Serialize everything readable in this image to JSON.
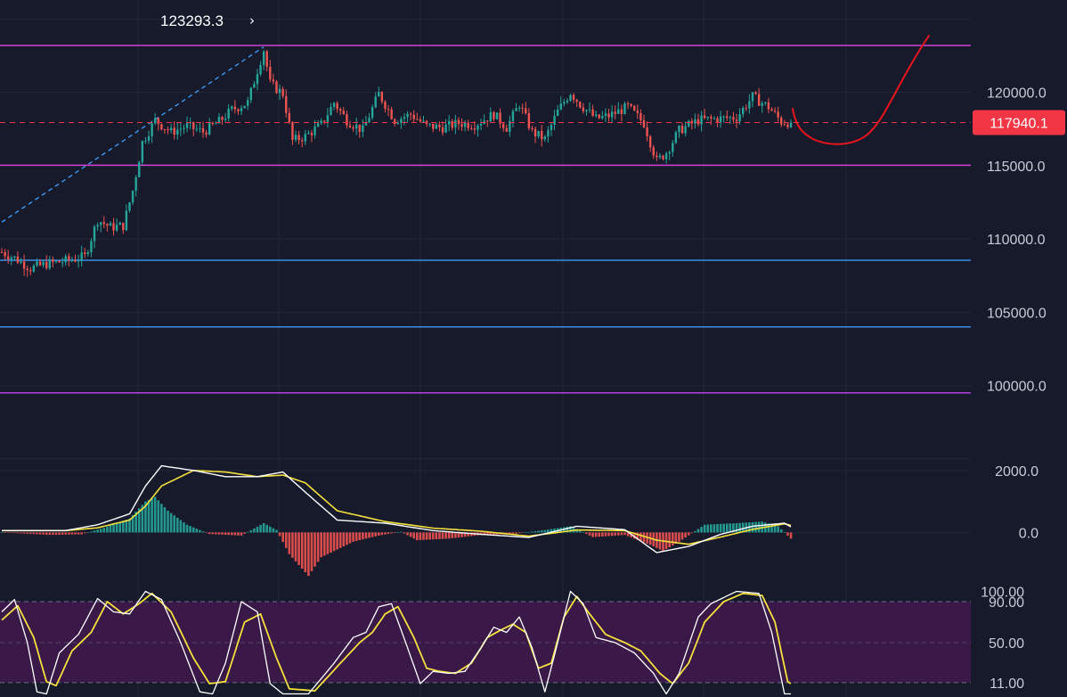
{
  "colors": {
    "background": "#161a2b",
    "grid": "#232838",
    "up": "#26a69a",
    "down": "#ef5350",
    "magenta_level": "#d63fd6",
    "blue_level": "#3b8ee8",
    "purple_level": "#b43fe0",
    "current_price": "#f23645",
    "trend_line": "#3fa0ff",
    "macd_line": "#ffffff",
    "signal_line": "#f5e03c",
    "stoch_k": "#ffffff",
    "stoch_d": "#f5e03c",
    "stoch_band": "#3a1948",
    "drawing": "#e8141e"
  },
  "chart_data": [
    {
      "name": "price",
      "type": "candlestick",
      "y_ticks": [
        "120000.0",
        "115000.0",
        "110000.0",
        "105000.0",
        "100000.0"
      ],
      "y_tick_values": [
        120000,
        115000,
        110000,
        105000,
        100000
      ],
      "ylim": [
        95900,
        126300
      ],
      "current_price": 117940.1,
      "current_price_label": "117940.1",
      "peak_value": 123293.3,
      "peak_label": "123293.3",
      "horizontal_levels": [
        {
          "value": 123200,
          "color": "magenta"
        },
        {
          "value": 115030,
          "color": "magenta"
        },
        {
          "value": 108550,
          "color": "blue"
        },
        {
          "value": 104000,
          "color": "blue"
        },
        {
          "value": 99500,
          "color": "purple"
        }
      ],
      "trend_line": {
        "from": [
          0,
          111150
        ],
        "to": [
          82,
          123100
        ],
        "style": "dashed"
      },
      "key_closes": [
        {
          "i": 0,
          "c": 109100
        },
        {
          "i": 4,
          "c": 108700
        },
        {
          "i": 9,
          "c": 108000
        },
        {
          "i": 14,
          "c": 108300
        },
        {
          "i": 20,
          "c": 108500
        },
        {
          "i": 26,
          "c": 108800
        },
        {
          "i": 30,
          "c": 111300
        },
        {
          "i": 34,
          "c": 110800
        },
        {
          "i": 38,
          "c": 110900
        },
        {
          "i": 41,
          "c": 113300
        },
        {
          "i": 44,
          "c": 116600
        },
        {
          "i": 48,
          "c": 118100
        },
        {
          "i": 53,
          "c": 117300
        },
        {
          "i": 58,
          "c": 117700
        },
        {
          "i": 63,
          "c": 117300
        },
        {
          "i": 68,
          "c": 118000
        },
        {
          "i": 72,
          "c": 118800
        },
        {
          "i": 77,
          "c": 119300
        },
        {
          "i": 80,
          "c": 121500
        },
        {
          "i": 82,
          "c": 122900
        },
        {
          "i": 84,
          "c": 120600
        },
        {
          "i": 88,
          "c": 119900
        },
        {
          "i": 91,
          "c": 116700
        },
        {
          "i": 95,
          "c": 117000
        },
        {
          "i": 100,
          "c": 117800
        },
        {
          "i": 104,
          "c": 119300
        },
        {
          "i": 108,
          "c": 118100
        },
        {
          "i": 113,
          "c": 117400
        },
        {
          "i": 118,
          "c": 119900
        },
        {
          "i": 123,
          "c": 118100
        },
        {
          "i": 128,
          "c": 118500
        },
        {
          "i": 133,
          "c": 117700
        },
        {
          "i": 138,
          "c": 117600
        },
        {
          "i": 143,
          "c": 117900
        },
        {
          "i": 148,
          "c": 117800
        },
        {
          "i": 154,
          "c": 118500
        },
        {
          "i": 158,
          "c": 117600
        },
        {
          "i": 162,
          "c": 119200
        },
        {
          "i": 166,
          "c": 117300
        },
        {
          "i": 170,
          "c": 116800
        },
        {
          "i": 174,
          "c": 118700
        },
        {
          "i": 178,
          "c": 120000
        },
        {
          "i": 181,
          "c": 119200
        },
        {
          "i": 186,
          "c": 118200
        },
        {
          "i": 190,
          "c": 118400
        },
        {
          "i": 196,
          "c": 119000
        },
        {
          "i": 201,
          "c": 117900
        },
        {
          "i": 205,
          "c": 115300
        },
        {
          "i": 208,
          "c": 115900
        },
        {
          "i": 212,
          "c": 117400
        },
        {
          "i": 218,
          "c": 118100
        },
        {
          "i": 224,
          "c": 118200
        },
        {
          "i": 230,
          "c": 118300
        },
        {
          "i": 235,
          "c": 119700
        },
        {
          "i": 240,
          "c": 119000
        },
        {
          "i": 244,
          "c": 118000
        },
        {
          "i": 247,
          "c": 117940
        }
      ]
    },
    {
      "name": "macd",
      "type": "line+histogram",
      "y_ticks": [
        "2000.0",
        "0.0"
      ],
      "y_tick_values": [
        2000,
        0
      ],
      "ylim": [
        -1800,
        2800
      ],
      "macd_points": [
        [
          0,
          60
        ],
        [
          20,
          60
        ],
        [
          30,
          250
        ],
        [
          40,
          600
        ],
        [
          45,
          1500
        ],
        [
          50,
          2150
        ],
        [
          60,
          2000
        ],
        [
          70,
          1800
        ],
        [
          80,
          1800
        ],
        [
          88,
          1950
        ],
        [
          95,
          1300
        ],
        [
          105,
          400
        ],
        [
          120,
          300
        ],
        [
          135,
          60
        ],
        [
          150,
          -60
        ],
        [
          165,
          -160
        ],
        [
          180,
          200
        ],
        [
          195,
          90
        ],
        [
          205,
          -650
        ],
        [
          215,
          -450
        ],
        [
          225,
          -60
        ],
        [
          235,
          200
        ],
        [
          245,
          300
        ],
        [
          247,
          180
        ]
      ],
      "signal_points": [
        [
          0,
          60
        ],
        [
          20,
          60
        ],
        [
          30,
          150
        ],
        [
          40,
          400
        ],
        [
          45,
          850
        ],
        [
          50,
          1500
        ],
        [
          60,
          2000
        ],
        [
          70,
          1950
        ],
        [
          80,
          1800
        ],
        [
          88,
          1850
        ],
        [
          95,
          1600
        ],
        [
          105,
          700
        ],
        [
          120,
          350
        ],
        [
          135,
          140
        ],
        [
          150,
          40
        ],
        [
          165,
          -120
        ],
        [
          180,
          80
        ],
        [
          195,
          60
        ],
        [
          205,
          -250
        ],
        [
          215,
          -380
        ],
        [
          225,
          -150
        ],
        [
          235,
          100
        ],
        [
          245,
          280
        ],
        [
          247,
          230
        ]
      ],
      "histogram_points": [
        [
          0,
          0
        ],
        [
          15,
          -80
        ],
        [
          25,
          -60
        ],
        [
          32,
          150
        ],
        [
          40,
          450
        ],
        [
          45,
          1000
        ],
        [
          48,
          1150
        ],
        [
          52,
          700
        ],
        [
          58,
          250
        ],
        [
          65,
          -50
        ],
        [
          75,
          -100
        ],
        [
          82,
          300
        ],
        [
          86,
          80
        ],
        [
          90,
          -700
        ],
        [
          96,
          -1400
        ],
        [
          100,
          -800
        ],
        [
          110,
          -300
        ],
        [
          118,
          -100
        ],
        [
          125,
          20
        ],
        [
          130,
          -250
        ],
        [
          140,
          -200
        ],
        [
          150,
          -80
        ],
        [
          160,
          -50
        ],
        [
          170,
          80
        ],
        [
          178,
          200
        ],
        [
          185,
          -150
        ],
        [
          195,
          -80
        ],
        [
          203,
          -400
        ],
        [
          207,
          -600
        ],
        [
          212,
          -300
        ],
        [
          220,
          250
        ],
        [
          230,
          300
        ],
        [
          238,
          350
        ],
        [
          243,
          200
        ],
        [
          247,
          -200
        ]
      ]
    },
    {
      "name": "stoch_rsi",
      "type": "line",
      "y_ticks": [
        "100.00",
        "90.00",
        "50.00",
        "11.00"
      ],
      "y_tick_values": [
        100,
        90,
        50,
        11
      ],
      "ylim": [
        -3,
        103
      ],
      "band": [
        11,
        90
      ],
      "k_points": [
        [
          0,
          80
        ],
        [
          4,
          92
        ],
        [
          8,
          50
        ],
        [
          11,
          2
        ],
        [
          14,
          0
        ],
        [
          18,
          40
        ],
        [
          24,
          58
        ],
        [
          30,
          93
        ],
        [
          35,
          80
        ],
        [
          40,
          78
        ],
        [
          45,
          100
        ],
        [
          50,
          92
        ],
        [
          56,
          50
        ],
        [
          62,
          2
        ],
        [
          66,
          0
        ],
        [
          70,
          30
        ],
        [
          75,
          90
        ],
        [
          80,
          80
        ],
        [
          84,
          10
        ],
        [
          88,
          0
        ],
        [
          96,
          0
        ],
        [
          104,
          30
        ],
        [
          110,
          55
        ],
        [
          114,
          60
        ],
        [
          118,
          85
        ],
        [
          122,
          88
        ],
        [
          127,
          45
        ],
        [
          131,
          10
        ],
        [
          135,
          22
        ],
        [
          140,
          20
        ],
        [
          145,
          22
        ],
        [
          150,
          45
        ],
        [
          154,
          65
        ],
        [
          158,
          60
        ],
        [
          162,
          75
        ],
        [
          166,
          45
        ],
        [
          170,
          2
        ],
        [
          174,
          50
        ],
        [
          178,
          100
        ],
        [
          182,
          88
        ],
        [
          186,
          55
        ],
        [
          192,
          50
        ],
        [
          198,
          40
        ],
        [
          204,
          20
        ],
        [
          208,
          0
        ],
        [
          212,
          20
        ],
        [
          218,
          75
        ],
        [
          222,
          88
        ],
        [
          230,
          100
        ],
        [
          237,
          98
        ],
        [
          241,
          60
        ],
        [
          245,
          0
        ],
        [
          247,
          0
        ]
      ],
      "d_points": [
        [
          0,
          72
        ],
        [
          5,
          86
        ],
        [
          10,
          55
        ],
        [
          14,
          12
        ],
        [
          17,
          8
        ],
        [
          22,
          42
        ],
        [
          28,
          60
        ],
        [
          33,
          90
        ],
        [
          38,
          78
        ],
        [
          43,
          88
        ],
        [
          47,
          98
        ],
        [
          53,
          80
        ],
        [
          60,
          35
        ],
        [
          65,
          10
        ],
        [
          70,
          12
        ],
        [
          76,
          70
        ],
        [
          81,
          78
        ],
        [
          86,
          35
        ],
        [
          90,
          5
        ],
        [
          98,
          3
        ],
        [
          106,
          30
        ],
        [
          112,
          50
        ],
        [
          116,
          60
        ],
        [
          120,
          78
        ],
        [
          124,
          85
        ],
        [
          129,
          55
        ],
        [
          133,
          25
        ],
        [
          137,
          22
        ],
        [
          142,
          20
        ],
        [
          147,
          30
        ],
        [
          152,
          55
        ],
        [
          156,
          62
        ],
        [
          160,
          68
        ],
        [
          164,
          60
        ],
        [
          168,
          25
        ],
        [
          172,
          30
        ],
        [
          176,
          75
        ],
        [
          180,
          95
        ],
        [
          184,
          78
        ],
        [
          189,
          58
        ],
        [
          195,
          50
        ],
        [
          200,
          42
        ],
        [
          206,
          20
        ],
        [
          210,
          10
        ],
        [
          215,
          30
        ],
        [
          220,
          70
        ],
        [
          226,
          90
        ],
        [
          232,
          98
        ],
        [
          238,
          96
        ],
        [
          242,
          70
        ],
        [
          246,
          12
        ],
        [
          247,
          10
        ]
      ]
    }
  ]
}
